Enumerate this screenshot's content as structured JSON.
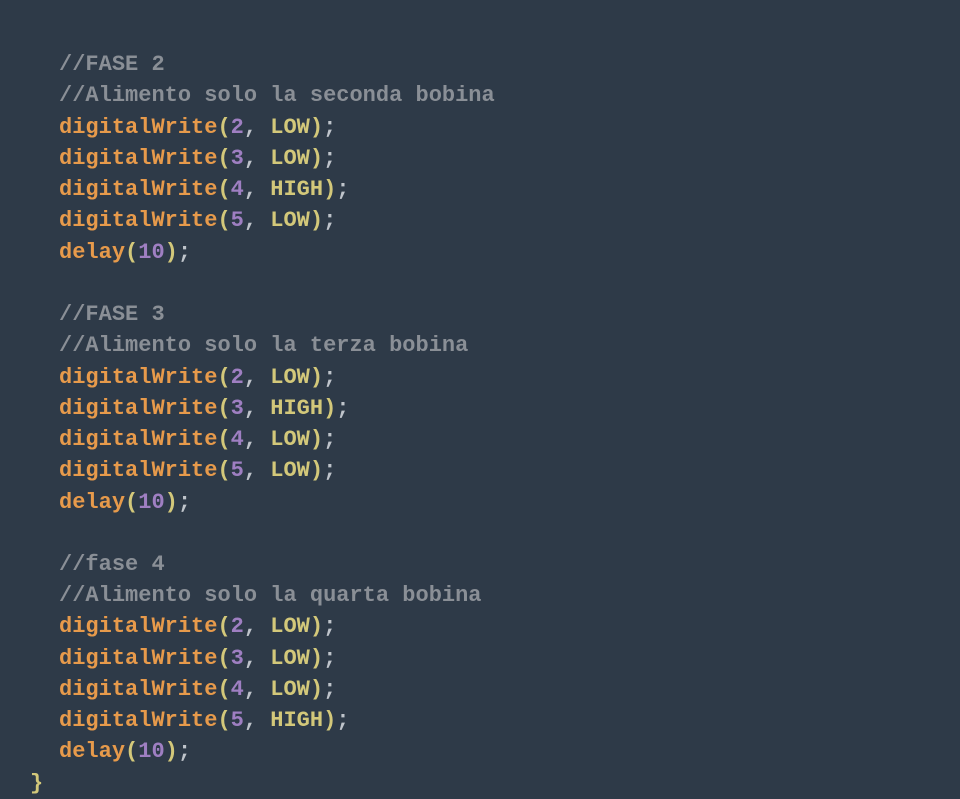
{
  "code": {
    "phase2": {
      "comment1": "//FASE 2",
      "comment2": "//Alimento solo la seconda bobina",
      "l1_fn": "digitalWrite",
      "l1_n": "2",
      "l1_v": "LOW",
      "l2_fn": "digitalWrite",
      "l2_n": "3",
      "l2_v": "LOW",
      "l3_fn": "digitalWrite",
      "l3_n": "4",
      "l3_v": "HIGH",
      "l4_fn": "digitalWrite",
      "l4_n": "5",
      "l4_v": "LOW",
      "dfn": "delay",
      "dn": "10"
    },
    "phase3": {
      "comment1": "//FASE 3",
      "comment2": "//Alimento solo la terza bobina",
      "l1_fn": "digitalWrite",
      "l1_n": "2",
      "l1_v": "LOW",
      "l2_fn": "digitalWrite",
      "l2_n": "3",
      "l2_v": "HIGH",
      "l3_fn": "digitalWrite",
      "l3_n": "4",
      "l3_v": "LOW",
      "l4_fn": "digitalWrite",
      "l4_n": "5",
      "l4_v": "LOW",
      "dfn": "delay",
      "dn": "10"
    },
    "phase4": {
      "comment1": "//fase 4",
      "comment2": "//Alimento solo la quarta bobina",
      "l1_fn": "digitalWrite",
      "l1_n": "2",
      "l1_v": "LOW",
      "l2_fn": "digitalWrite",
      "l2_n": "3",
      "l2_v": "LOW",
      "l3_fn": "digitalWrite",
      "l3_n": "4",
      "l3_v": "LOW",
      "l4_fn": "digitalWrite",
      "l4_n": "5",
      "l4_v": "HIGH",
      "dfn": "delay",
      "dn": "10"
    },
    "close_brace": "}"
  }
}
